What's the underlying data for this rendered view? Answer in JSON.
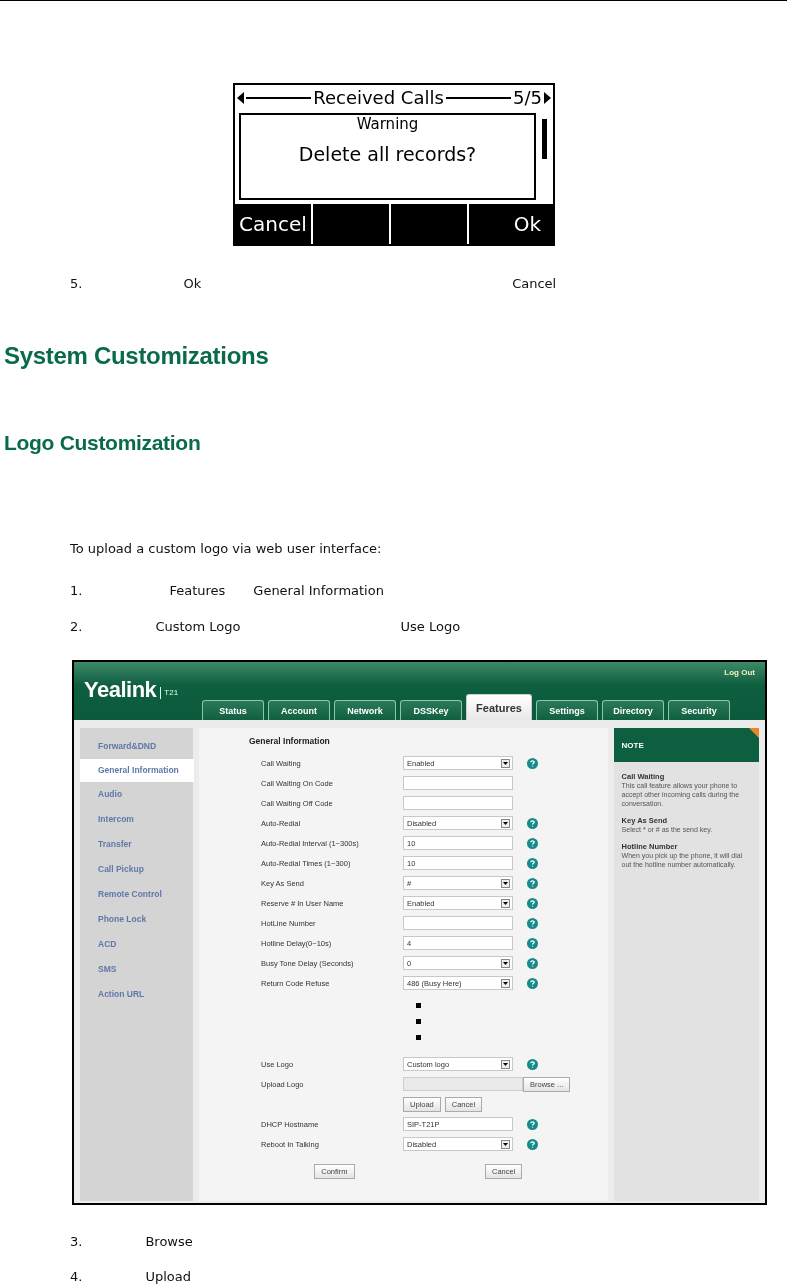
{
  "phone_screen": {
    "title": "Received Calls",
    "page": "5/5",
    "dialog_title": "Warning",
    "message": "Delete all records?",
    "left_softkey": "Cancel",
    "right_softkey": "Ok"
  },
  "step_5": {
    "number": "5.",
    "parts": [
      "Ok",
      "Cancel"
    ]
  },
  "heading": "System Customizations",
  "subheading": "Logo Customization",
  "intro": "To upload a custom logo via web user interface:",
  "steps_before": [
    {
      "number": "1.",
      "parts": [
        "Features",
        "General Information"
      ]
    },
    {
      "number": "2.",
      "parts": [
        "Custom Logo",
        "Use Logo"
      ]
    }
  ],
  "web_ui": {
    "logo": "Yealink",
    "model": "T21",
    "logout": "Log Out",
    "tabs": [
      {
        "label": "Status",
        "selected": false
      },
      {
        "label": "Account",
        "selected": false
      },
      {
        "label": "Network",
        "selected": false
      },
      {
        "label": "DSSKey",
        "selected": false
      },
      {
        "label": "Features",
        "selected": true
      },
      {
        "label": "Settings",
        "selected": false
      },
      {
        "label": "Directory",
        "selected": false
      },
      {
        "label": "Security",
        "selected": false
      }
    ],
    "sidebar": [
      {
        "label": "Forward&DND",
        "selected": false
      },
      {
        "label": "General Information",
        "selected": true
      },
      {
        "label": "Audio",
        "selected": false
      },
      {
        "label": "Intercom",
        "selected": false
      },
      {
        "label": "Transfer",
        "selected": false
      },
      {
        "label": "Call Pickup",
        "selected": false
      },
      {
        "label": "Remote Control",
        "selected": false
      },
      {
        "label": "Phone Lock",
        "selected": false
      },
      {
        "label": "ACD",
        "selected": false
      },
      {
        "label": "SMS",
        "selected": false
      },
      {
        "label": "Action URL",
        "selected": false
      }
    ],
    "section_title": "General Information",
    "fields": [
      {
        "kind": "select",
        "label": "Call Waiting",
        "value": "Enabled",
        "help": true
      },
      {
        "kind": "text",
        "label": "Call Waiting On Code",
        "help": false
      },
      {
        "kind": "text",
        "label": "Call Waiting Off Code",
        "help": false
      },
      {
        "kind": "select",
        "label": "Auto-Redial",
        "value": "Disabled",
        "help": true
      },
      {
        "kind": "text",
        "label": "Auto-Redial Interval (1~300s)",
        "value": "10",
        "help": true
      },
      {
        "kind": "text",
        "label": "Auto-Redial Times (1~300)",
        "value": "10",
        "help": true
      },
      {
        "kind": "select",
        "label": "Key As Send",
        "value": "#",
        "help": true
      },
      {
        "kind": "select",
        "label": "Reserve # In User Name",
        "value": "Enabled",
        "help": true
      },
      {
        "kind": "text",
        "label": "HotLine Number",
        "help": true
      },
      {
        "kind": "text",
        "label": "Hotline Delay(0~10s)",
        "value": "4",
        "help": true
      },
      {
        "kind": "select",
        "label": "Busy Tone Delay (Seconds)",
        "value": "0",
        "help": true
      },
      {
        "kind": "select",
        "label": "Return Code Refuse",
        "value": "486 (Busy Here)",
        "help": true
      }
    ],
    "more_fields": [
      {
        "kind": "select",
        "label": "Use Logo",
        "value": "Custom logo",
        "help": true
      },
      {
        "kind": "file",
        "label": "Upload Logo",
        "button": "Browse ...",
        "help": false
      },
      {
        "kind": "buttons",
        "buttons": [
          "Upload",
          "Cancel"
        ]
      },
      {
        "kind": "text",
        "label": "DHCP Hostname",
        "value": "SIP-T21P",
        "help": true
      },
      {
        "kind": "select",
        "label": "Reboot In Talking",
        "value": "Disabled",
        "help": true
      }
    ],
    "confirm": "Confirm",
    "cancel": "Cancel",
    "note": {
      "title": "NOTE",
      "entries": [
        {
          "title": "Call Waiting",
          "text": "This call feature allows your phone to accept other incoming calls during the conversation."
        },
        {
          "title": "Key As Send",
          "text": "Select * or # as the send key."
        },
        {
          "title": "Hotline Number",
          "text": "When you pick up the phone, it will dial out the hotline number automatically."
        }
      ]
    }
  },
  "steps_after": [
    {
      "number": "3.",
      "parts": [
        "Browse"
      ]
    },
    {
      "number": "4.",
      "parts": [
        "Upload"
      ]
    }
  ]
}
